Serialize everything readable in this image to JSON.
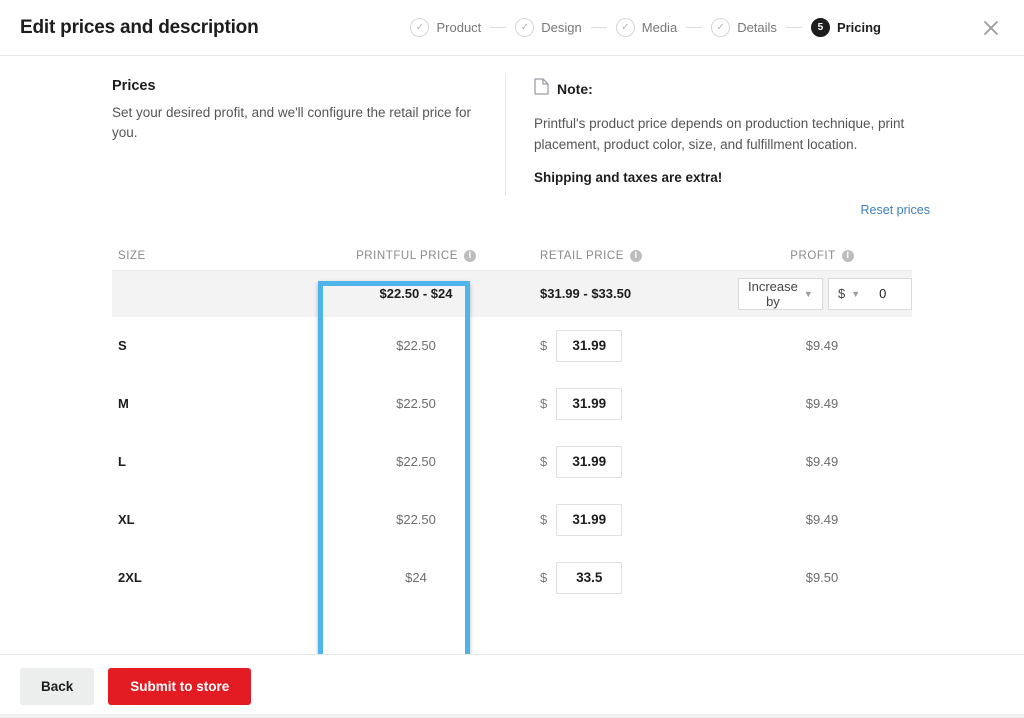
{
  "header": {
    "title": "Edit prices and description",
    "close_icon": "close-icon",
    "steps": [
      {
        "label": "Product",
        "state": "done",
        "marker": "✓"
      },
      {
        "label": "Design",
        "state": "done",
        "marker": "✓"
      },
      {
        "label": "Media",
        "state": "done",
        "marker": "✓"
      },
      {
        "label": "Details",
        "state": "done",
        "marker": "✓"
      },
      {
        "label": "Pricing",
        "state": "active",
        "marker": "5"
      }
    ]
  },
  "prices": {
    "title": "Prices",
    "subtitle": "Set your desired profit, and we'll configure the retail price for you."
  },
  "note": {
    "icon": "document-icon",
    "label": "Note:",
    "body": "Printful's product price depends on production technique, print placement, product color, size, and fulfillment location.",
    "emphasis": "Shipping and taxes are extra!"
  },
  "reset": {
    "label": "Reset prices"
  },
  "table": {
    "columns": {
      "size": "SIZE",
      "printful_price": "PRINTFUL PRICE",
      "retail_price": "RETAIL PRICE",
      "profit": "PROFIT"
    },
    "info_glyph": "i",
    "summary": {
      "printful_range": "$22.50 - $24",
      "retail_range": "$31.99 - $33.50",
      "adjust_mode": "Increase by",
      "adjust_unit": "$",
      "adjust_value": "0"
    },
    "currency_symbol": "$",
    "rows": [
      {
        "size": "S",
        "printful_price": "$22.50",
        "retail_price": "31.99",
        "profit": "$9.49"
      },
      {
        "size": "M",
        "printful_price": "$22.50",
        "retail_price": "31.99",
        "profit": "$9.49"
      },
      {
        "size": "L",
        "printful_price": "$22.50",
        "retail_price": "31.99",
        "profit": "$9.49"
      },
      {
        "size": "XL",
        "printful_price": "$22.50",
        "retail_price": "31.99",
        "profit": "$9.49"
      },
      {
        "size": "2XL",
        "printful_price": "$24",
        "retail_price": "33.5",
        "profit": "$9.50"
      }
    ]
  },
  "footer": {
    "back_label": "Back",
    "submit_label": "Submit to store"
  },
  "colors": {
    "highlight": "#4fb4e9",
    "submit": "#e31b23",
    "link": "#3f7fc1",
    "active_step": "#1d1d1d"
  }
}
